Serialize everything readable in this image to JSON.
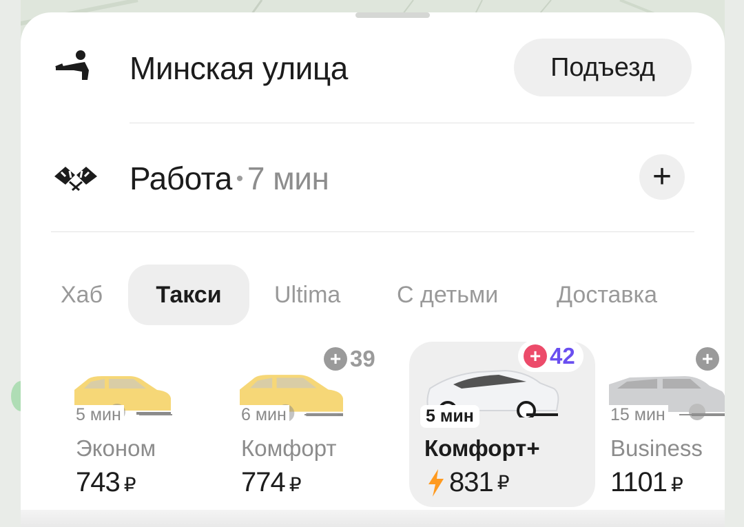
{
  "route": {
    "pickup": {
      "icon": "pickup-person-icon",
      "address": "Минская улица",
      "entrance_label": "Подъезд"
    },
    "destination": {
      "icon": "checkered-flags-icon",
      "name": "Работа",
      "separator": "•",
      "duration": "7 мин",
      "add_stop": "+"
    }
  },
  "tabs": [
    {
      "label": "Хаб",
      "active": false
    },
    {
      "label": "Такси",
      "active": true
    },
    {
      "label": "Ultima",
      "active": false
    },
    {
      "label": "С детьми",
      "active": false
    },
    {
      "label": "Доставка",
      "active": false
    }
  ],
  "tariffs": [
    {
      "name": "Эконом",
      "eta": "5 мин",
      "price": "743",
      "currency": "₽",
      "car_icon": "yellow-taxi-icon",
      "car_color": "#f6d777"
    },
    {
      "name": "Комфорт",
      "eta": "6 мин",
      "price": "774",
      "currency": "₽",
      "plus_points": "39",
      "car_icon": "yellow-taxi-icon",
      "car_color": "#f6d777"
    },
    {
      "name": "Комфорт+",
      "eta": "5 мин",
      "price": "831",
      "currency": "₽",
      "plus_points": "42",
      "surge_icon": "lightning-icon",
      "selected": true,
      "car_icon": "white-sedan-icon",
      "car_color": "#f2f3f5"
    },
    {
      "name": "Business",
      "eta": "15 мин",
      "price": "1101",
      "currency": "₽",
      "car_icon": "gray-sedan-icon",
      "car_color": "#cfd0d2"
    }
  ],
  "colors": {
    "plus_badge_accent": "#ec4b6a",
    "plus_points_text": "#6a4ff0",
    "surge": "#ff9a1f"
  }
}
